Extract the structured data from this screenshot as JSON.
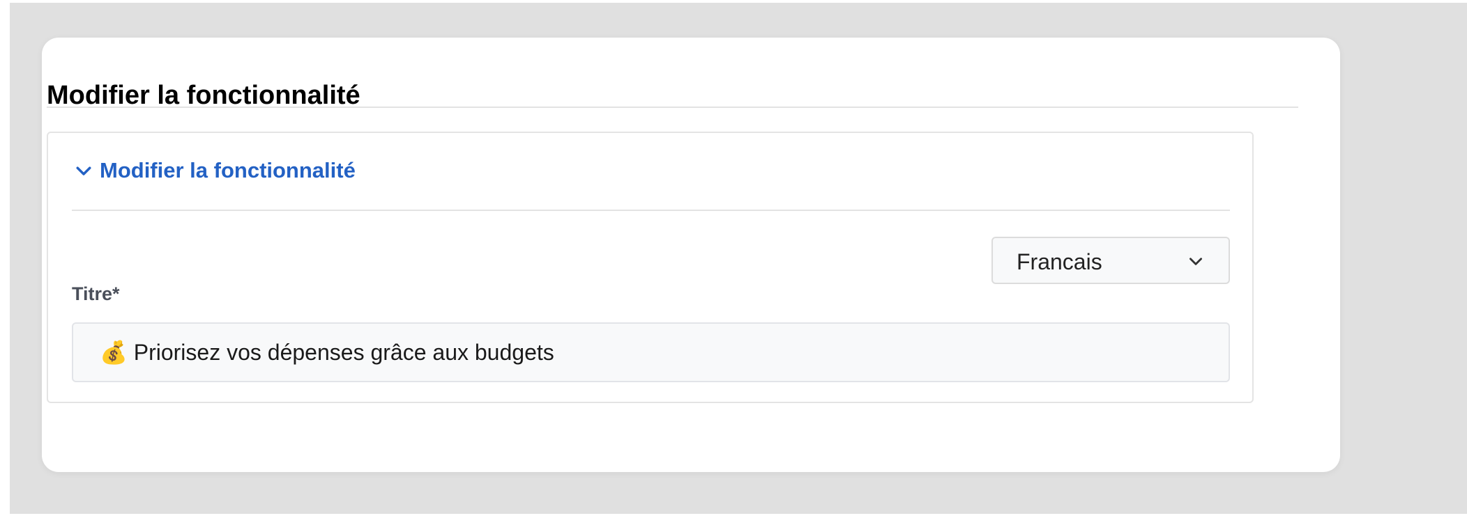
{
  "page": {
    "title": "Modifier la fonctionnalité"
  },
  "section": {
    "title": "Modifier la fonctionnalité",
    "expand_icon": "chevron-down-icon"
  },
  "language_select": {
    "selected": "Francais",
    "icon": "chevron-down-icon"
  },
  "title_field": {
    "label": "Titre*",
    "value": "💰 Priorisez vos dépenses grâce aux budgets"
  },
  "colors": {
    "accent": "#2361c4",
    "background": "#e0e0e0",
    "card": "#ffffff",
    "input_background": "#f8f9fa"
  }
}
